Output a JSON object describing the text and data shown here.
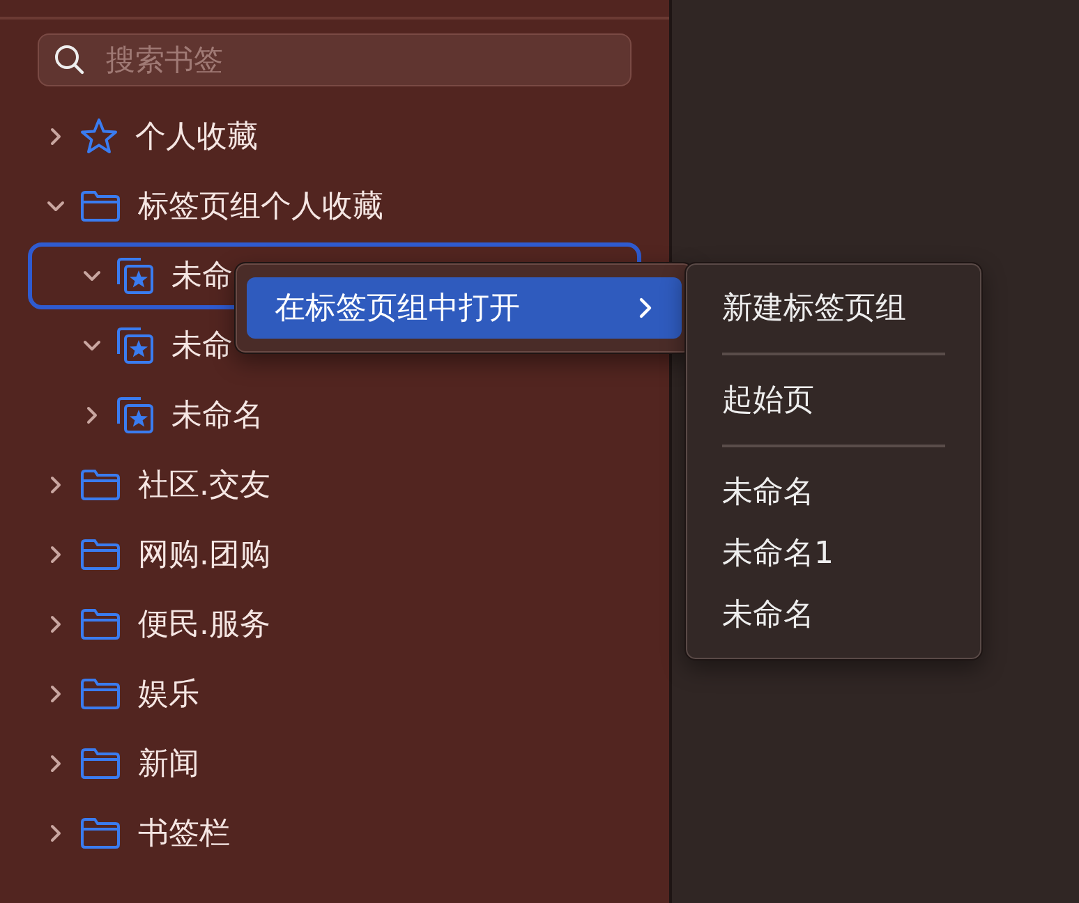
{
  "search": {
    "placeholder": "搜索书签"
  },
  "tree": [
    {
      "label": "个人收藏",
      "kind": "star",
      "expanded": false,
      "selected": false
    },
    {
      "label": "标签页组个人收藏",
      "kind": "folder",
      "expanded": true,
      "selected": false,
      "children": [
        {
          "label": "未命",
          "kind": "tabgroup",
          "expanded": true,
          "selected": true
        },
        {
          "label": "未命",
          "kind": "tabgroup",
          "expanded": true,
          "selected": false
        },
        {
          "label": "未命名",
          "kind": "tabgroup",
          "expanded": false,
          "selected": false
        }
      ]
    },
    {
      "label": "社区.交友",
      "kind": "folder",
      "expanded": false,
      "selected": false
    },
    {
      "label": "网购.团购",
      "kind": "folder",
      "expanded": false,
      "selected": false
    },
    {
      "label": "便民.服务",
      "kind": "folder",
      "expanded": false,
      "selected": false
    },
    {
      "label": "娱乐",
      "kind": "folder",
      "expanded": false,
      "selected": false
    },
    {
      "label": "新闻",
      "kind": "folder",
      "expanded": false,
      "selected": false
    },
    {
      "label": "书签栏",
      "kind": "folder",
      "expanded": false,
      "selected": false
    }
  ],
  "context_menu": {
    "items": [
      {
        "label": "在标签页组中打开",
        "selected": true,
        "has_submenu": true
      }
    ]
  },
  "submenu": {
    "items": [
      {
        "label": "新建标签页组",
        "kind": "item"
      },
      {
        "kind": "separator"
      },
      {
        "label": "起始页",
        "kind": "item"
      },
      {
        "kind": "separator"
      },
      {
        "label": "未命名",
        "kind": "item"
      },
      {
        "label": "未命名1",
        "kind": "item"
      },
      {
        "label": "未命名",
        "kind": "item"
      }
    ]
  }
}
